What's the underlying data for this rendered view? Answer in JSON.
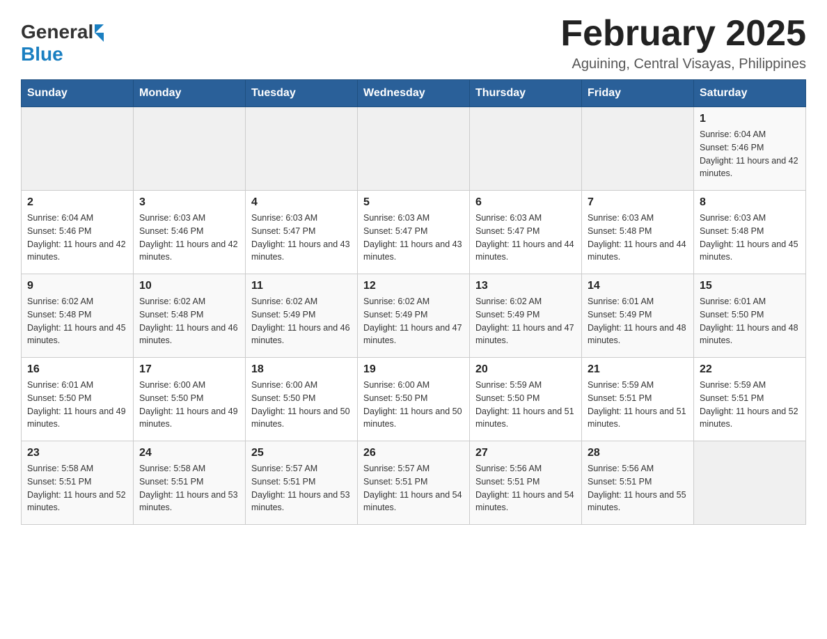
{
  "header": {
    "title": "February 2025",
    "subtitle": "Aguining, Central Visayas, Philippines"
  },
  "logo": {
    "general": "General",
    "blue": "Blue"
  },
  "days_of_week": [
    "Sunday",
    "Monday",
    "Tuesday",
    "Wednesday",
    "Thursday",
    "Friday",
    "Saturday"
  ],
  "weeks": [
    [
      {
        "date": "",
        "info": ""
      },
      {
        "date": "",
        "info": ""
      },
      {
        "date": "",
        "info": ""
      },
      {
        "date": "",
        "info": ""
      },
      {
        "date": "",
        "info": ""
      },
      {
        "date": "",
        "info": ""
      },
      {
        "date": "1",
        "info": "Sunrise: 6:04 AM\nSunset: 5:46 PM\nDaylight: 11 hours and 42 minutes."
      }
    ],
    [
      {
        "date": "2",
        "info": "Sunrise: 6:04 AM\nSunset: 5:46 PM\nDaylight: 11 hours and 42 minutes."
      },
      {
        "date": "3",
        "info": "Sunrise: 6:03 AM\nSunset: 5:46 PM\nDaylight: 11 hours and 42 minutes."
      },
      {
        "date": "4",
        "info": "Sunrise: 6:03 AM\nSunset: 5:47 PM\nDaylight: 11 hours and 43 minutes."
      },
      {
        "date": "5",
        "info": "Sunrise: 6:03 AM\nSunset: 5:47 PM\nDaylight: 11 hours and 43 minutes."
      },
      {
        "date": "6",
        "info": "Sunrise: 6:03 AM\nSunset: 5:47 PM\nDaylight: 11 hours and 44 minutes."
      },
      {
        "date": "7",
        "info": "Sunrise: 6:03 AM\nSunset: 5:48 PM\nDaylight: 11 hours and 44 minutes."
      },
      {
        "date": "8",
        "info": "Sunrise: 6:03 AM\nSunset: 5:48 PM\nDaylight: 11 hours and 45 minutes."
      }
    ],
    [
      {
        "date": "9",
        "info": "Sunrise: 6:02 AM\nSunset: 5:48 PM\nDaylight: 11 hours and 45 minutes."
      },
      {
        "date": "10",
        "info": "Sunrise: 6:02 AM\nSunset: 5:48 PM\nDaylight: 11 hours and 46 minutes."
      },
      {
        "date": "11",
        "info": "Sunrise: 6:02 AM\nSunset: 5:49 PM\nDaylight: 11 hours and 46 minutes."
      },
      {
        "date": "12",
        "info": "Sunrise: 6:02 AM\nSunset: 5:49 PM\nDaylight: 11 hours and 47 minutes."
      },
      {
        "date": "13",
        "info": "Sunrise: 6:02 AM\nSunset: 5:49 PM\nDaylight: 11 hours and 47 minutes."
      },
      {
        "date": "14",
        "info": "Sunrise: 6:01 AM\nSunset: 5:49 PM\nDaylight: 11 hours and 48 minutes."
      },
      {
        "date": "15",
        "info": "Sunrise: 6:01 AM\nSunset: 5:50 PM\nDaylight: 11 hours and 48 minutes."
      }
    ],
    [
      {
        "date": "16",
        "info": "Sunrise: 6:01 AM\nSunset: 5:50 PM\nDaylight: 11 hours and 49 minutes."
      },
      {
        "date": "17",
        "info": "Sunrise: 6:00 AM\nSunset: 5:50 PM\nDaylight: 11 hours and 49 minutes."
      },
      {
        "date": "18",
        "info": "Sunrise: 6:00 AM\nSunset: 5:50 PM\nDaylight: 11 hours and 50 minutes."
      },
      {
        "date": "19",
        "info": "Sunrise: 6:00 AM\nSunset: 5:50 PM\nDaylight: 11 hours and 50 minutes."
      },
      {
        "date": "20",
        "info": "Sunrise: 5:59 AM\nSunset: 5:50 PM\nDaylight: 11 hours and 51 minutes."
      },
      {
        "date": "21",
        "info": "Sunrise: 5:59 AM\nSunset: 5:51 PM\nDaylight: 11 hours and 51 minutes."
      },
      {
        "date": "22",
        "info": "Sunrise: 5:59 AM\nSunset: 5:51 PM\nDaylight: 11 hours and 52 minutes."
      }
    ],
    [
      {
        "date": "23",
        "info": "Sunrise: 5:58 AM\nSunset: 5:51 PM\nDaylight: 11 hours and 52 minutes."
      },
      {
        "date": "24",
        "info": "Sunrise: 5:58 AM\nSunset: 5:51 PM\nDaylight: 11 hours and 53 minutes."
      },
      {
        "date": "25",
        "info": "Sunrise: 5:57 AM\nSunset: 5:51 PM\nDaylight: 11 hours and 53 minutes."
      },
      {
        "date": "26",
        "info": "Sunrise: 5:57 AM\nSunset: 5:51 PM\nDaylight: 11 hours and 54 minutes."
      },
      {
        "date": "27",
        "info": "Sunrise: 5:56 AM\nSunset: 5:51 PM\nDaylight: 11 hours and 54 minutes."
      },
      {
        "date": "28",
        "info": "Sunrise: 5:56 AM\nSunset: 5:51 PM\nDaylight: 11 hours and 55 minutes."
      },
      {
        "date": "",
        "info": ""
      }
    ]
  ]
}
